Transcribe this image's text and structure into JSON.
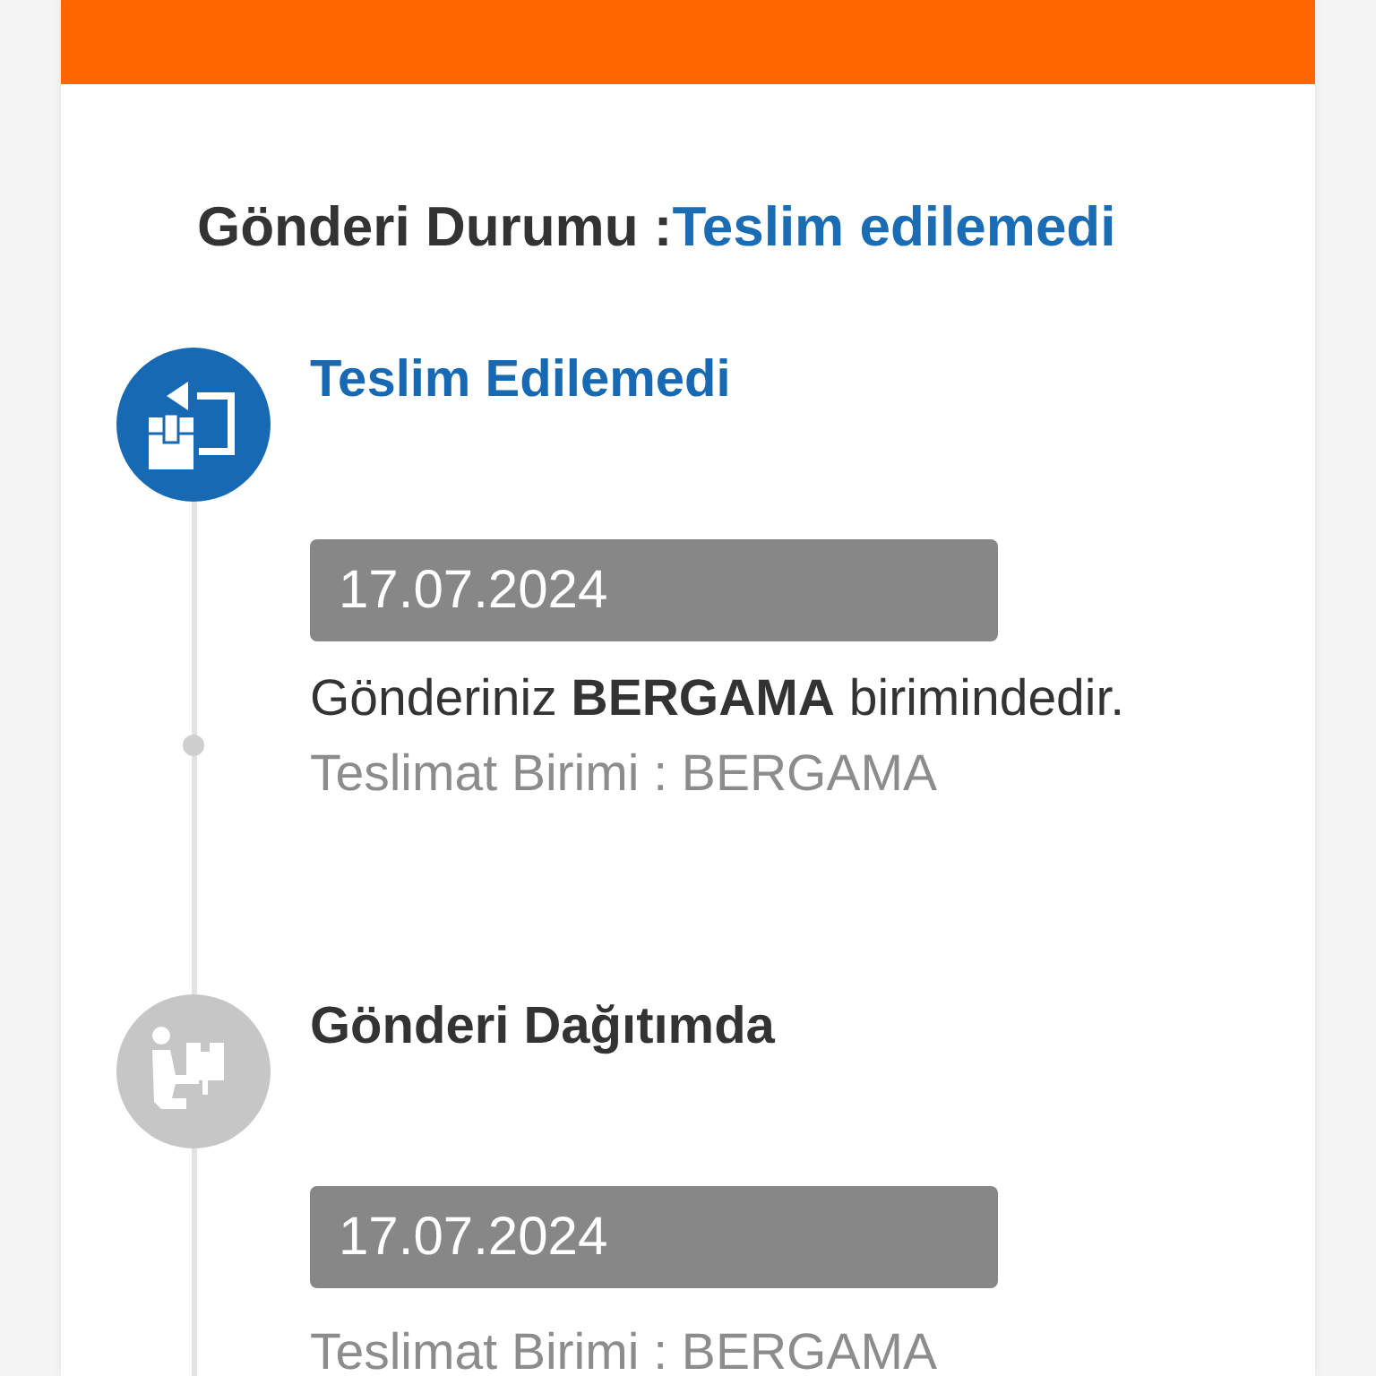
{
  "shipment_status": {
    "label": "Gönderi Durumu :",
    "value": "Teslim edilemedi"
  },
  "events": [
    {
      "kind": "undelivered",
      "active": true,
      "title": "Teslim Edilemedi",
      "date": "17.07.2024",
      "description": "Gönderiniz **BERGAMA** birimindedir.",
      "unit": "Teslimat Birimi : BERGAMA"
    },
    {
      "kind": "courier",
      "active": false,
      "title": "Gönderi Dağıtımda",
      "date": "17.07.2024",
      "unit": "Teslimat Birimi : BERGAMA"
    }
  ]
}
